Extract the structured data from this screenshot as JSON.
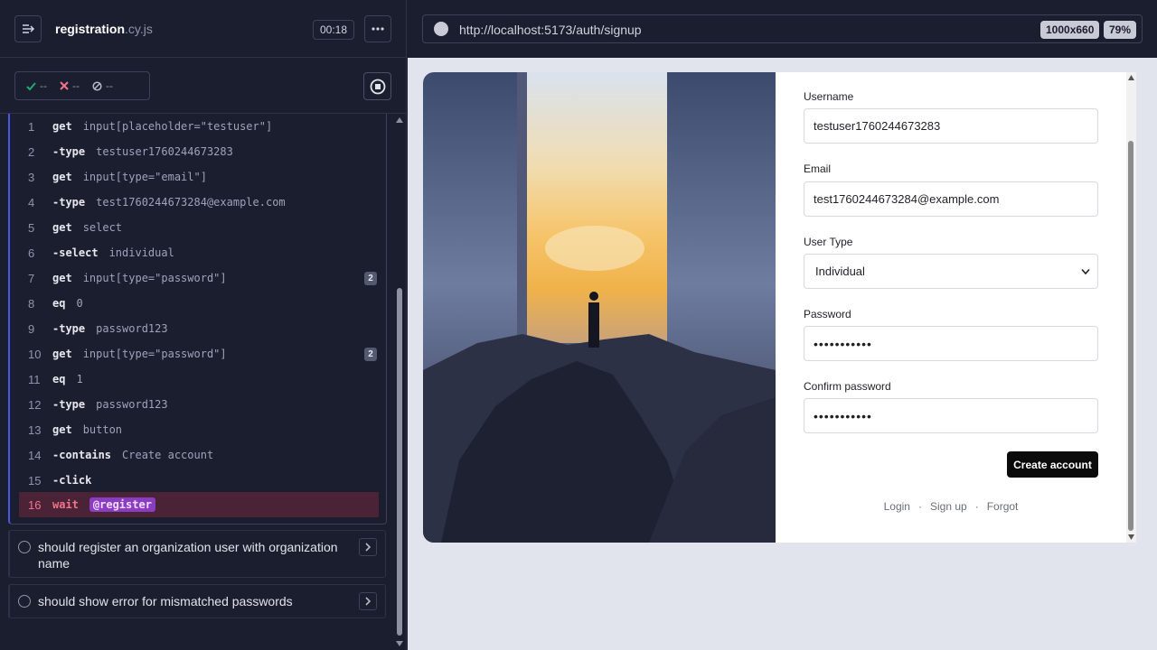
{
  "runner": {
    "spec_name": "registration",
    "spec_ext": ".cy.js",
    "timer": "00:18",
    "stats": {
      "passed": "--",
      "failed": "--",
      "pending": "--"
    },
    "commands": [
      {
        "num": "1",
        "kw": "get",
        "arg": "input[placeholder=\"testuser\"]"
      },
      {
        "num": "2",
        "kw": "-type",
        "arg": "testuser1760244673283"
      },
      {
        "num": "3",
        "kw": "get",
        "arg": "input[type=\"email\"]"
      },
      {
        "num": "4",
        "kw": "-type",
        "arg": "test1760244673284@example.com"
      },
      {
        "num": "5",
        "kw": "get",
        "arg": "select"
      },
      {
        "num": "6",
        "kw": "-select",
        "arg": "individual"
      },
      {
        "num": "7",
        "kw": "get",
        "arg": "input[type=\"password\"]",
        "badge": "2"
      },
      {
        "num": "8",
        "kw": "eq",
        "arg": "0"
      },
      {
        "num": "9",
        "kw": "-type",
        "arg": "password123"
      },
      {
        "num": "10",
        "kw": "get",
        "arg": "input[type=\"password\"]",
        "badge": "2"
      },
      {
        "num": "11",
        "kw": "eq",
        "arg": "1"
      },
      {
        "num": "12",
        "kw": "-type",
        "arg": "password123"
      },
      {
        "num": "13",
        "kw": "get",
        "arg": "button"
      },
      {
        "num": "14",
        "kw": "-contains",
        "arg": "Create account"
      },
      {
        "num": "15",
        "kw": "-click",
        "arg": ""
      },
      {
        "num": "16",
        "kw": "wait",
        "arg": "@register"
      }
    ],
    "tests": [
      {
        "title": "should register an organization user with organization name"
      },
      {
        "title": "should show error for mismatched passwords"
      }
    ]
  },
  "aut": {
    "url": "http://localhost:5173/auth/signup",
    "viewport": "1000x660",
    "zoom": "79%"
  },
  "form": {
    "username_label": "Username",
    "username_value": "testuser1760244673283",
    "email_label": "Email",
    "email_value": "test1760244673284@example.com",
    "usertype_label": "User Type",
    "usertype_value": "Individual",
    "password_label": "Password",
    "password_value": "•••••••••••",
    "confirm_label": "Confirm password",
    "confirm_value": "•••••••••••",
    "submit_label": "Create account",
    "links": [
      "Login",
      "Sign up",
      "Forgot"
    ],
    "separator": "·"
  },
  "colors": {
    "runner_bg": "#1b1e2e",
    "accent": "#4956e3",
    "active_cmd": "#f4738c",
    "alias_bg": "#8b3dc2"
  }
}
